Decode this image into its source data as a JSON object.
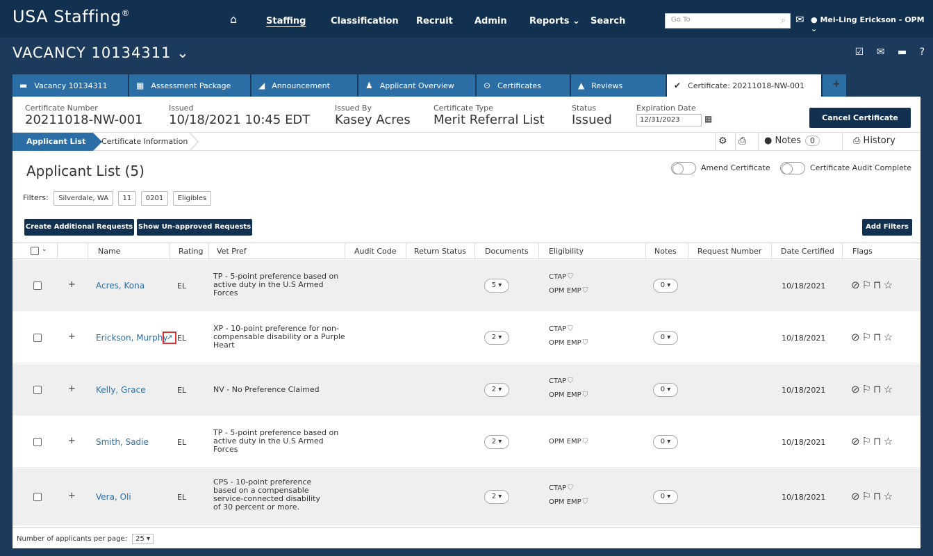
{
  "topnav": {
    "brand": "USA Staffing",
    "brand_mark": "®",
    "items": [
      "Staffing",
      "Classification",
      "Recruit",
      "Admin",
      "Reports ⌄",
      "Search"
    ],
    "goto_placeholder": "Go To",
    "user": "Mei-Ling Erickson - OPM ⌄"
  },
  "vacancy": {
    "title": "VACANCY 10134311 ⌄"
  },
  "tabs": [
    "Vacancy 10134311",
    "Assessment Package",
    "Announcement",
    "Applicant Overview",
    "Certificates",
    "Reviews",
    "Certificate: 20211018-NW-001"
  ],
  "certificate": {
    "number_label": "Certificate Number",
    "number": "20211018-NW-001",
    "issued_label": "Issued",
    "issued": "10/18/2021 10:45 EDT",
    "issued_by_label": "Issued By",
    "issued_by": "Kasey Acres",
    "type_label": "Certificate Type",
    "type": "Merit Referral List",
    "status_label": "Status",
    "status": "Issued",
    "expiration_label": "Expiration Date",
    "expiration": "12/31/2023",
    "cancel_label": "Cancel Certificate"
  },
  "subnav": {
    "applicant_list": "Applicant List",
    "certificate_info": "Certificate Information",
    "notes_label": "Notes",
    "notes_count": "0",
    "history_label": "History"
  },
  "applicant_list": {
    "title": "Applicant List (5)",
    "amend_label": "Amend Certificate",
    "audit_label": "Certificate Audit Complete",
    "filters_label": "Filters:",
    "filters": [
      "Silverdale, WA",
      "11",
      "0201",
      "Eligibles"
    ],
    "create_btn": "Create Additional Requests",
    "show_btn": "Show Un-approved Requests",
    "add_filters_btn": "Add Filters"
  },
  "table": {
    "headers": [
      "Name",
      "Rating",
      "Vet Pref",
      "Audit Code",
      "Return Status",
      "Documents",
      "Eligibility",
      "Notes",
      "Request Number",
      "Date Certified",
      "Flags"
    ],
    "rows": [
      {
        "name": "Acres, Kona",
        "rating": "EL",
        "vet": "TP - 5-point preference based on active duty in the U.S Armed Forces",
        "docs": "5 ▾",
        "elig1": "CTAP",
        "elig2": "OPM EMP",
        "notes": "0 ▾",
        "date": "10/18/2021"
      },
      {
        "name": "Erickson, Murphy",
        "rating": "EL",
        "vet": "XP - 10-point preference for non-compensable disability or a Purple Heart",
        "docs": "2 ▾",
        "elig1": "CTAP",
        "elig2": "OPM EMP",
        "notes": "0 ▾",
        "date": "10/18/2021"
      },
      {
        "name": "Kelly, Grace",
        "rating": "EL",
        "vet": "NV - No Preference Claimed",
        "docs": "2 ▾",
        "elig1": "CTAP",
        "elig2": "OPM EMP",
        "notes": "0 ▾",
        "date": "10/18/2021"
      },
      {
        "name": "Smith, Sadie",
        "rating": "EL",
        "vet": "TP - 5-point preference based on active duty in the U.S Armed Forces",
        "docs": "2 ▾",
        "elig1": "",
        "elig2": "OPM EMP",
        "notes": "0 ▾",
        "date": "10/18/2021"
      },
      {
        "name": "Vera, Oli",
        "rating": "EL",
        "vet": "CPS - 10-point preference based on a compensable service-connected disability of 30 percent or more.",
        "docs": "2 ▾",
        "elig1": "CTAP",
        "elig2": "OPM EMP",
        "notes": "0 ▾",
        "date": "10/18/2021"
      }
    ],
    "flags_glyphs": "⊘⚐⊓☆"
  },
  "footer": {
    "per_page_label": "Number of applicants per page:",
    "per_page": "25 ▾"
  }
}
